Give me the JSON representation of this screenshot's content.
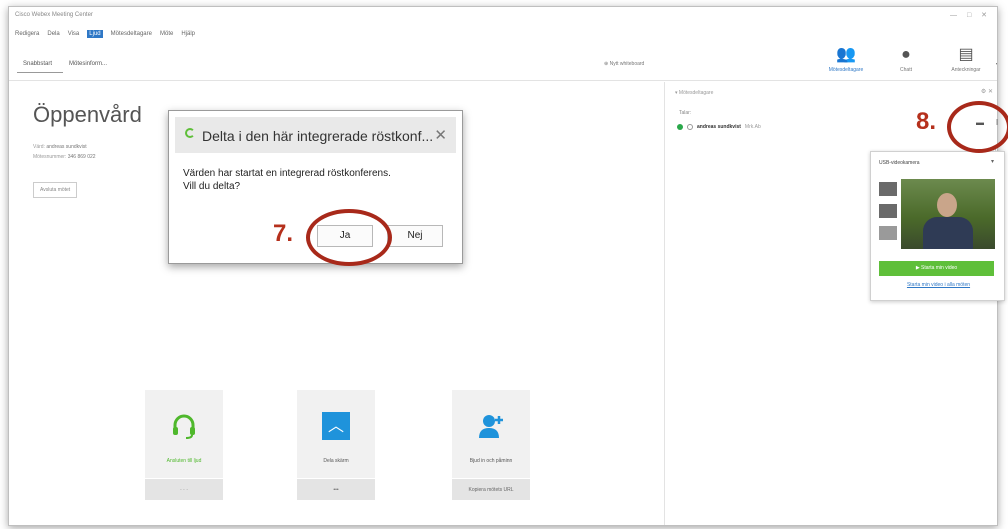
{
  "window": {
    "title": "Cisco Webex Meeting Center"
  },
  "menu": [
    {
      "label": "Redigera",
      "active": false
    },
    {
      "label": "Dela",
      "active": false
    },
    {
      "label": "Visa",
      "active": false
    },
    {
      "label": "Ljud",
      "active": true
    },
    {
      "label": "Mötesdeltagare",
      "active": false
    },
    {
      "label": "Möte",
      "active": false
    },
    {
      "label": "Hjälp",
      "active": false
    }
  ],
  "tabs": [
    {
      "label": "Snabbstart"
    },
    {
      "label": "Mötesinform..."
    }
  ],
  "whiteboard_label": "Nytt whiteboard",
  "toolbar": [
    {
      "label": "Mötesdeltagare",
      "icon": "participants-icon"
    },
    {
      "label": "Chatt",
      "icon": "chat-icon"
    },
    {
      "label": "Anteckningar",
      "icon": "notes-icon"
    }
  ],
  "meeting": {
    "title": "Öppenvård",
    "host_label": "Värd:",
    "host_name": "andreas sundkvist",
    "number_label": "Mötesnummer:",
    "number": "346 869 022",
    "cancel_label": "Avsluta mötet"
  },
  "panel": {
    "title": "Mötesdeltagare",
    "section": "Talar:",
    "participant_name": "andreas sundkvist",
    "participant_suffix": "Mrk.Ab"
  },
  "video_popup": {
    "title": "USB-videokamera",
    "start_label": "Starta min video",
    "start_all_label": "Starta min video i alla möten"
  },
  "dialog": {
    "title": "Delta i den här integrerade röstkonf...",
    "close": "✕",
    "message_line1": "Värden har startat en integrerad röstkonferens.",
    "message_line2": "Vill du delta?",
    "yes_label": "Ja",
    "no_label": "Nej"
  },
  "annotations": {
    "step7": "7.",
    "step8": "8."
  },
  "cards": [
    {
      "label": "Ansluten till ljud",
      "sub": "· · ·"
    },
    {
      "label": "Dela skärm",
      "sub": "•••"
    },
    {
      "label": "Bjud in och påminn",
      "sub": "Kopiera mötets URL"
    }
  ],
  "colors": {
    "accent": "#2f78c6",
    "green": "#5fbf3a",
    "annotation_red": "#a8291a",
    "share_blue": "#1f93db"
  }
}
